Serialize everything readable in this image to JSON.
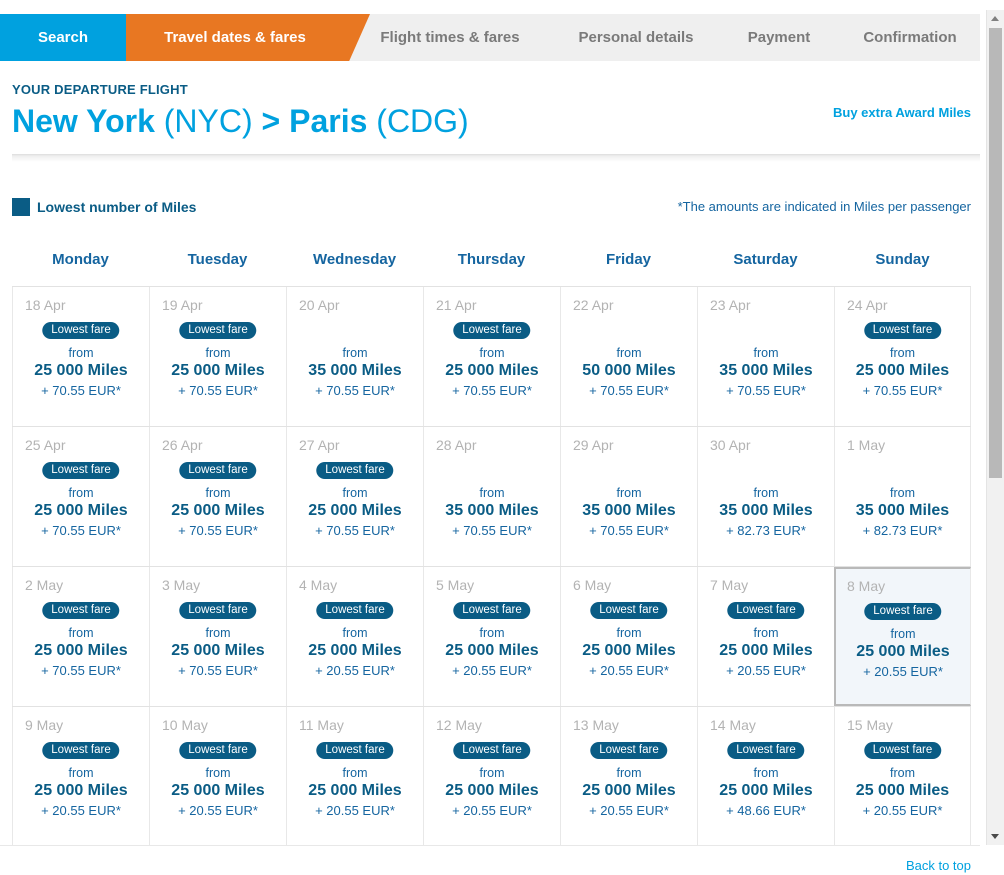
{
  "steps": [
    {
      "label": "Search",
      "state": "done"
    },
    {
      "label": "Travel dates & fares",
      "state": "active"
    },
    {
      "label": "Flight times & fares",
      "state": "upcoming"
    },
    {
      "label": "Personal details",
      "state": "upcoming"
    },
    {
      "label": "Payment",
      "state": "upcoming"
    },
    {
      "label": "Confirmation",
      "state": "upcoming"
    }
  ],
  "header": {
    "eyebrow": "YOUR DEPARTURE FLIGHT",
    "origin_city": "New York",
    "origin_code": "(NYC)",
    "arrow": ">",
    "destination_city": "Paris",
    "destination_code": "(CDG)",
    "buy_miles_link": "Buy extra Award Miles"
  },
  "legend": {
    "swatch_color": "#0a5c85",
    "label": "Lowest number of Miles",
    "note": "*The amounts are indicated in Miles per passenger"
  },
  "calendar": {
    "day_headers": [
      "Monday",
      "Tuesday",
      "Wednesday",
      "Thursday",
      "Friday",
      "Saturday",
      "Sunday"
    ],
    "from_label": "from",
    "badge_label": "Lowest fare",
    "weeks": [
      [
        {
          "date": "18 Apr",
          "badge": true,
          "miles": "25 000 Miles",
          "eur": "+ 70.55 EUR*",
          "selected": false
        },
        {
          "date": "19 Apr",
          "badge": true,
          "miles": "25 000 Miles",
          "eur": "+ 70.55 EUR*",
          "selected": false
        },
        {
          "date": "20 Apr",
          "badge": false,
          "miles": "35 000 Miles",
          "eur": "+ 70.55 EUR*",
          "selected": false
        },
        {
          "date": "21 Apr",
          "badge": true,
          "miles": "25 000 Miles",
          "eur": "+ 70.55 EUR*",
          "selected": false
        },
        {
          "date": "22 Apr",
          "badge": false,
          "miles": "50 000 Miles",
          "eur": "+ 70.55 EUR*",
          "selected": false
        },
        {
          "date": "23 Apr",
          "badge": false,
          "miles": "35 000 Miles",
          "eur": "+ 70.55 EUR*",
          "selected": false
        },
        {
          "date": "24 Apr",
          "badge": true,
          "miles": "25 000 Miles",
          "eur": "+ 70.55 EUR*",
          "selected": false
        }
      ],
      [
        {
          "date": "25 Apr",
          "badge": true,
          "miles": "25 000 Miles",
          "eur": "+ 70.55 EUR*",
          "selected": false
        },
        {
          "date": "26 Apr",
          "badge": true,
          "miles": "25 000 Miles",
          "eur": "+ 70.55 EUR*",
          "selected": false
        },
        {
          "date": "27 Apr",
          "badge": true,
          "miles": "25 000 Miles",
          "eur": "+ 70.55 EUR*",
          "selected": false
        },
        {
          "date": "28 Apr",
          "badge": false,
          "miles": "35 000 Miles",
          "eur": "+ 70.55 EUR*",
          "selected": false
        },
        {
          "date": "29 Apr",
          "badge": false,
          "miles": "35 000 Miles",
          "eur": "+ 70.55 EUR*",
          "selected": false
        },
        {
          "date": "30 Apr",
          "badge": false,
          "miles": "35 000 Miles",
          "eur": "+ 82.73 EUR*",
          "selected": false
        },
        {
          "date": "1 May",
          "badge": false,
          "miles": "35 000 Miles",
          "eur": "+ 82.73 EUR*",
          "selected": false
        }
      ],
      [
        {
          "date": "2 May",
          "badge": true,
          "miles": "25 000 Miles",
          "eur": "+ 70.55 EUR*",
          "selected": false
        },
        {
          "date": "3 May",
          "badge": true,
          "miles": "25 000 Miles",
          "eur": "+ 70.55 EUR*",
          "selected": false
        },
        {
          "date": "4 May",
          "badge": true,
          "miles": "25 000 Miles",
          "eur": "+ 20.55 EUR*",
          "selected": false
        },
        {
          "date": "5 May",
          "badge": true,
          "miles": "25 000 Miles",
          "eur": "+ 20.55 EUR*",
          "selected": false
        },
        {
          "date": "6 May",
          "badge": true,
          "miles": "25 000 Miles",
          "eur": "+ 20.55 EUR*",
          "selected": false
        },
        {
          "date": "7 May",
          "badge": true,
          "miles": "25 000 Miles",
          "eur": "+ 20.55 EUR*",
          "selected": false
        },
        {
          "date": "8 May",
          "badge": true,
          "miles": "25 000 Miles",
          "eur": "+ 20.55 EUR*",
          "selected": true
        }
      ],
      [
        {
          "date": "9 May",
          "badge": true,
          "miles": "25 000 Miles",
          "eur": "+ 20.55 EUR*",
          "selected": false
        },
        {
          "date": "10 May",
          "badge": true,
          "miles": "25 000 Miles",
          "eur": "+ 20.55 EUR*",
          "selected": false
        },
        {
          "date": "11 May",
          "badge": true,
          "miles": "25 000 Miles",
          "eur": "+ 20.55 EUR*",
          "selected": false
        },
        {
          "date": "12 May",
          "badge": true,
          "miles": "25 000 Miles",
          "eur": "+ 20.55 EUR*",
          "selected": false
        },
        {
          "date": "13 May",
          "badge": true,
          "miles": "25 000 Miles",
          "eur": "+ 20.55 EUR*",
          "selected": false
        },
        {
          "date": "14 May",
          "badge": true,
          "miles": "25 000 Miles",
          "eur": "+ 48.66 EUR*",
          "selected": false
        },
        {
          "date": "15 May",
          "badge": true,
          "miles": "25 000 Miles",
          "eur": "+ 20.55 EUR*",
          "selected": false
        }
      ]
    ]
  },
  "footer": {
    "back_to_top": "Back to top"
  },
  "colors": {
    "brand_blue": "#00a1df",
    "brand_orange": "#e87722",
    "deep_blue": "#0a5c85",
    "link_blue": "#1565a0"
  }
}
